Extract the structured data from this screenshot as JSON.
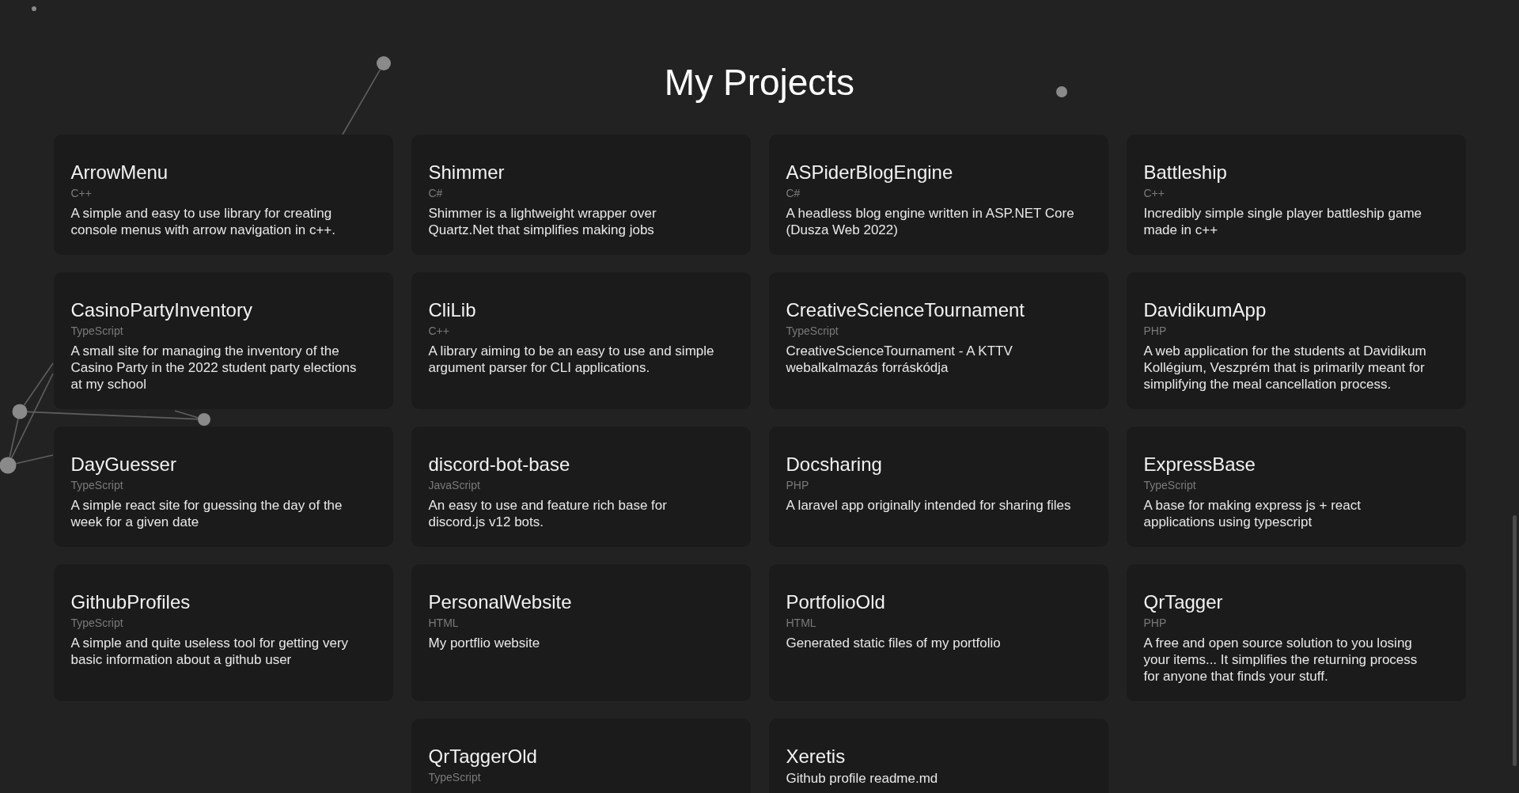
{
  "page": {
    "title": "My Projects"
  },
  "projects": [
    {
      "name": "ArrowMenu",
      "language": "C++",
      "description": "A simple and easy to use library for creating console menus with arrow navigation in c++."
    },
    {
      "name": "Shimmer",
      "language": "C#",
      "description": "Shimmer is a lightweight wrapper over Quartz.Net that simplifies making jobs"
    },
    {
      "name": "ASPiderBlogEngine",
      "language": "C#",
      "description": "A headless blog engine written in ASP.NET Core (Dusza Web 2022)"
    },
    {
      "name": "Battleship",
      "language": "C++",
      "description": "Incredibly simple single player battleship game made in c++"
    },
    {
      "name": "CasinoPartyInventory",
      "language": "TypeScript",
      "description": "A small site for managing the inventory of the Casino Party in the 2022 student party elections at my school"
    },
    {
      "name": "CliLib",
      "language": "C++",
      "description": "A library aiming to be an easy to use and simple argument parser for CLI applications."
    },
    {
      "name": "CreativeScienceTournament",
      "language": "TypeScript",
      "description": "CreativeScienceTournament - A KTTV webalkalmazás forráskódja"
    },
    {
      "name": "DavidikumApp",
      "language": "PHP",
      "description": "A web application for the students at Davidikum Kollégium, Veszprém that is primarily meant for simplifying the meal cancellation process."
    },
    {
      "name": "DayGuesser",
      "language": "TypeScript",
      "description": "A simple react site for guessing the day of the week for a given date"
    },
    {
      "name": "discord-bot-base",
      "language": "JavaScript",
      "description": "An easy to use and feature rich base for discord.js v12 bots."
    },
    {
      "name": "Docsharing",
      "language": "PHP",
      "description": "A laravel app originally intended for sharing files"
    },
    {
      "name": "ExpressBase",
      "language": "TypeScript",
      "description": "A base for making express js + react applications using typescript"
    },
    {
      "name": "GithubProfiles",
      "language": "TypeScript",
      "description": "A simple and quite useless tool for getting very basic information about a github user"
    },
    {
      "name": "PersonalWebsite",
      "language": "HTML",
      "description": "My portflio website"
    },
    {
      "name": "PortfolioOld",
      "language": "HTML",
      "description": "Generated static files of my portfolio"
    },
    {
      "name": "QrTagger",
      "language": "PHP",
      "description": "A free and open source solution to you losing your items... It simplifies the returning process for anyone that finds your stuff."
    },
    {
      "name": "QrTaggerOld",
      "language": "TypeScript"
    },
    {
      "name": "Xeretis",
      "description": "Github profile readme.md"
    }
  ]
}
